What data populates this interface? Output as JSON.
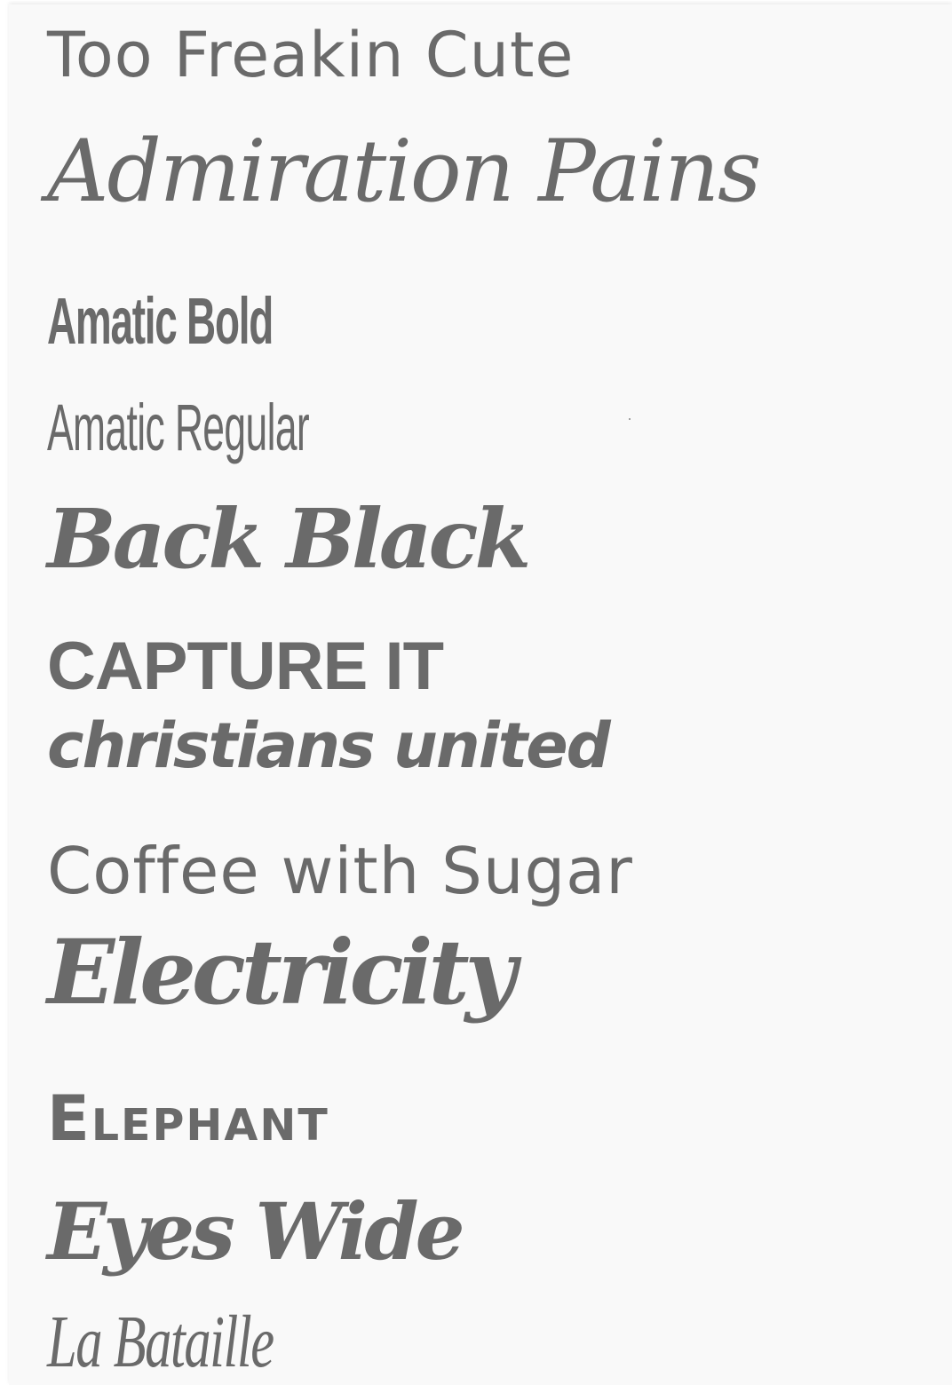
{
  "fonts": [
    {
      "name": "Too Freakin Cute"
    },
    {
      "name": "Admiration Pains"
    },
    {
      "name": "Amatic Bold"
    },
    {
      "name": "Amatic Regular"
    },
    {
      "name": "Back Black"
    },
    {
      "name": "CAPTURE IT"
    },
    {
      "name": "christians united"
    },
    {
      "name": "Coffee with Sugar"
    },
    {
      "name": "Electricity"
    },
    {
      "name": "Elephant"
    },
    {
      "name": "Eyes Wide"
    },
    {
      "name": "La Bataille"
    }
  ],
  "colors": {
    "text": "#6a6a6a",
    "background": "#f9f9f9"
  }
}
